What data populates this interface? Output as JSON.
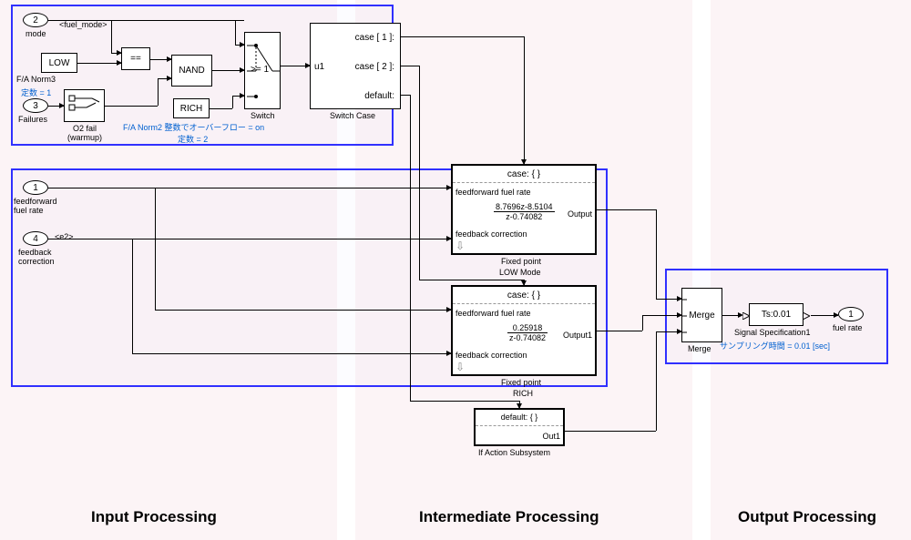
{
  "regions": {
    "input": "Input Processing",
    "intermediate": "Intermediate Processing",
    "output": "Output Processing"
  },
  "ports": {
    "p1": {
      "num": "1",
      "label": "feedforward\nfuel rate"
    },
    "p2": {
      "num": "2",
      "label": "mode"
    },
    "p3": {
      "num": "3",
      "label": "Failures"
    },
    "p4": {
      "num": "4",
      "label": "feedback\ncorrection"
    },
    "out1": {
      "num": "1",
      "label": "fuel rate"
    }
  },
  "top_group": {
    "signal_tag": "<fuel_mode>",
    "low_block": "LOW",
    "fa_norm3": "F/A Norm3",
    "const1_note": "定数 = 1",
    "o2fail": "O2 fail\n(warmup)",
    "compare": "==",
    "nand": "NAND",
    "rich": "RICH",
    "fa_norm2_note": "F/A Norm2 整数でオーバーフロー = on",
    "const2_note": "定数 = 2",
    "switch_thresh": ">= 1",
    "switch_label": "Switch"
  },
  "switch_case": {
    "case1": "case [ 1 ]:",
    "case2": "case [ 2 ]:",
    "default": "default:",
    "u1": "u1",
    "label": "Switch Case"
  },
  "fixed_point_low": {
    "header": "case: { }",
    "in1": "feedforward fuel rate",
    "in2": "feedback correction",
    "tf_num": "8.7696z-8.5104",
    "tf_den": "z-0.74082",
    "out": "Output",
    "label1": "Fixed point",
    "label2": "LOW Mode"
  },
  "fixed_point_rich": {
    "header": "case: { }",
    "in1": "feedforward fuel rate",
    "in2": "feedback correction",
    "tf_num": "0.25918",
    "tf_den": "z-0.74082",
    "out": "Output1",
    "label1": "Fixed point",
    "label2": "RICH"
  },
  "if_action": {
    "header": "default: { }",
    "out": "Out1",
    "label": "If Action Subsystem"
  },
  "merge": {
    "text": "Merge",
    "label": "Merge"
  },
  "signal_spec": {
    "text": "Ts:0.01",
    "label": "Signal Specification1",
    "note": "サンプリング時間 = 0.01 [sec]"
  },
  "e2_tag": "<e2>"
}
